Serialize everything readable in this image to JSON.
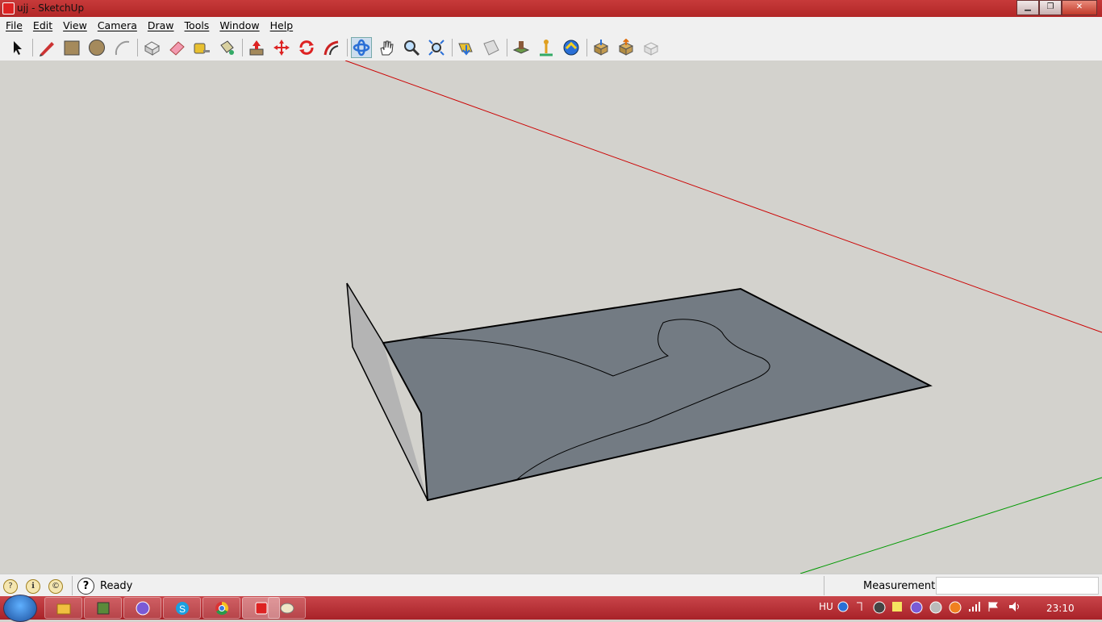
{
  "window": {
    "title": "ujj - SketchUp",
    "minimize": "▁",
    "maximize": "❐",
    "close": "✕"
  },
  "menu": [
    "File",
    "Edit",
    "View",
    "Camera",
    "Draw",
    "Tools",
    "Window",
    "Help"
  ],
  "toolbar": [
    {
      "name": "select-tool",
      "icon": "arrow"
    },
    {
      "name": "line-tool",
      "icon": "pencil"
    },
    {
      "name": "rectangle-tool",
      "icon": "rectangle"
    },
    {
      "name": "circle-tool",
      "icon": "circle"
    },
    {
      "name": "arc-tool",
      "icon": "arc"
    },
    {
      "name": "make-component-tool",
      "icon": "component"
    },
    {
      "name": "eraser-tool",
      "icon": "eraser"
    },
    {
      "name": "tape-measure-tool",
      "icon": "tape"
    },
    {
      "name": "paint-bucket-tool",
      "icon": "bucket"
    },
    {
      "name": "push-pull-tool",
      "icon": "pushpull"
    },
    {
      "name": "move-tool",
      "icon": "move"
    },
    {
      "name": "rotate-tool",
      "icon": "rotate"
    },
    {
      "name": "follow-me-tool",
      "icon": "followme"
    },
    {
      "name": "orbit-tool",
      "icon": "orbit",
      "active": true
    },
    {
      "name": "pan-tool",
      "icon": "hand"
    },
    {
      "name": "zoom-tool",
      "icon": "zoom"
    },
    {
      "name": "zoom-extents-tool",
      "icon": "zoomext"
    },
    {
      "name": "previous-view-tool",
      "icon": "prev"
    },
    {
      "name": "next-view-tool",
      "icon": "next"
    },
    {
      "name": "add-location-tool",
      "icon": "location"
    },
    {
      "name": "toggle-terrain-tool",
      "icon": "terrain"
    },
    {
      "name": "google-earth-tool",
      "icon": "earth"
    },
    {
      "name": "get-models-tool",
      "icon": "getmodels"
    },
    {
      "name": "share-model-tool",
      "icon": "share"
    },
    {
      "name": "share-component-tool",
      "icon": "sharecomp"
    }
  ],
  "status": {
    "text": "Ready",
    "measurements_label": "Measurements",
    "measurements_value": ""
  },
  "taskbar": {
    "apps": [
      "explorer",
      "minecraft",
      "app-c",
      "skype",
      "chrome",
      "sketchup",
      "paint"
    ],
    "language": "HU",
    "clock": "23:10"
  },
  "colors": {
    "model_face": "#737b83",
    "side_face": "#b4b4b4",
    "red_axis": "#cc0000",
    "green_axis": "#009900",
    "sky": "#d3d2cd"
  }
}
